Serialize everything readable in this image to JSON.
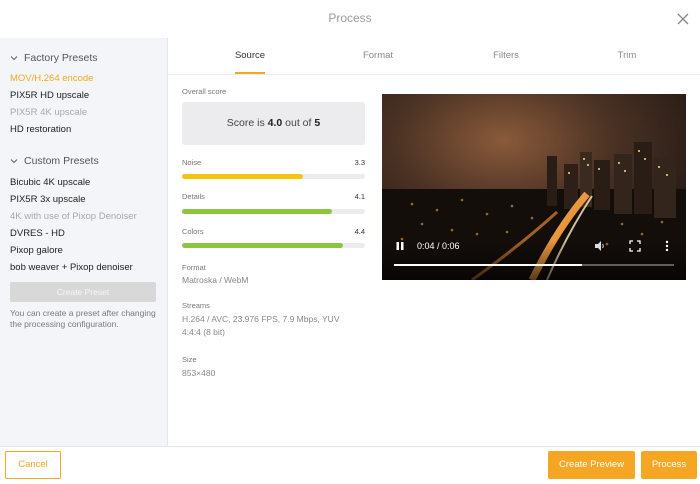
{
  "window": {
    "title": "Process"
  },
  "sidebar": {
    "factory_header": "Factory Presets",
    "factory_items": [
      {
        "label": "MOV/H.264 encode",
        "state": "active"
      },
      {
        "label": "PIX5R HD upscale",
        "state": "normal"
      },
      {
        "label": "PIX5R 4K upscale",
        "state": "dim"
      },
      {
        "label": "HD restoration",
        "state": "normal"
      }
    ],
    "custom_header": "Custom Presets",
    "custom_items": [
      {
        "label": "Bicubic 4K upscale",
        "state": "normal"
      },
      {
        "label": "PIX5R 3x upscale",
        "state": "normal"
      },
      {
        "label": "4K with use of Pixop Denoiser",
        "state": "dim"
      },
      {
        "label": "DVRES - HD",
        "state": "normal"
      },
      {
        "label": "Pixop galore",
        "state": "normal"
      },
      {
        "label": "bob weaver + Pixop denoiser",
        "state": "normal"
      }
    ],
    "create_preset_label": "Create Preset",
    "hint": "You can create a preset after changing the processing configuration."
  },
  "tabs": [
    {
      "label": "Source",
      "active": true
    },
    {
      "label": "Format",
      "active": false
    },
    {
      "label": "Filters",
      "active": false
    },
    {
      "label": "Trim",
      "active": false
    }
  ],
  "source": {
    "overall_label": "Overall score",
    "score_prefix": "Score is ",
    "score_value": "4.0",
    "score_mid": " out of ",
    "score_max": "5",
    "metrics": [
      {
        "name": "Noise",
        "value": "3.3",
        "fraction": 0.66,
        "color": "#f2c40f"
      },
      {
        "name": "Details",
        "value": "4.1",
        "fraction": 0.82,
        "color": "#8cc63f"
      },
      {
        "name": "Colors",
        "value": "4.4",
        "fraction": 0.88,
        "color": "#8cc63f"
      }
    ],
    "format_label": "Format",
    "format_value": "Matroska / WebM",
    "streams_label": "Streams",
    "streams_line1": "H.264 / AVC, 23.976 FPS, 7.9 Mbps, YUV",
    "streams_line2": "4:4:4 (8 bit)",
    "size_label": "Size",
    "size_value": "853×480"
  },
  "video": {
    "time": "0:04 / 0:06",
    "progress": 0.67,
    "icons": [
      "pause-icon",
      "volume-icon",
      "fullscreen-icon",
      "more-options-icon"
    ]
  },
  "footer": {
    "cancel_label": "Cancel",
    "create_preview_label": "Create Preview",
    "process_label": "Process"
  },
  "colors": {
    "accent": "#f5a623",
    "sidebar_bg": "#f4f5f8"
  }
}
